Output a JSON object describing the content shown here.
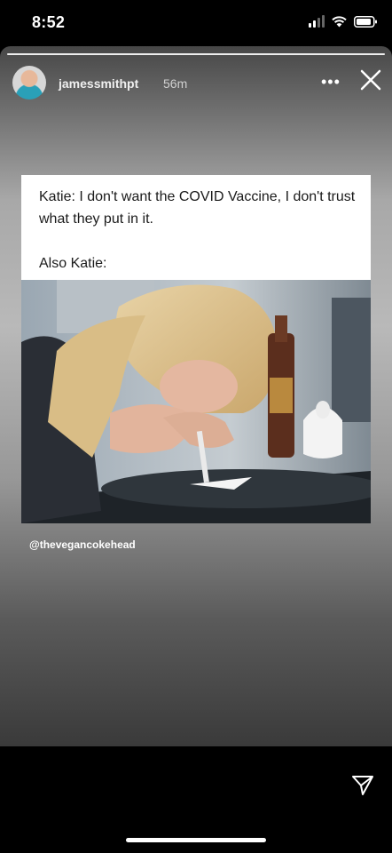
{
  "status_bar": {
    "time": "8:52"
  },
  "story": {
    "username": "jamessmithpt",
    "time_ago": "56m",
    "progress": 1.0
  },
  "post": {
    "line_1": "Katie: I don't want the COVID Vaccine, I don't trust what they put in it.",
    "line_2": "Also Katie:",
    "credit": "@thevegancokehead"
  },
  "icons": {
    "more": "more-options-icon",
    "close": "close-icon",
    "share": "send-icon"
  }
}
